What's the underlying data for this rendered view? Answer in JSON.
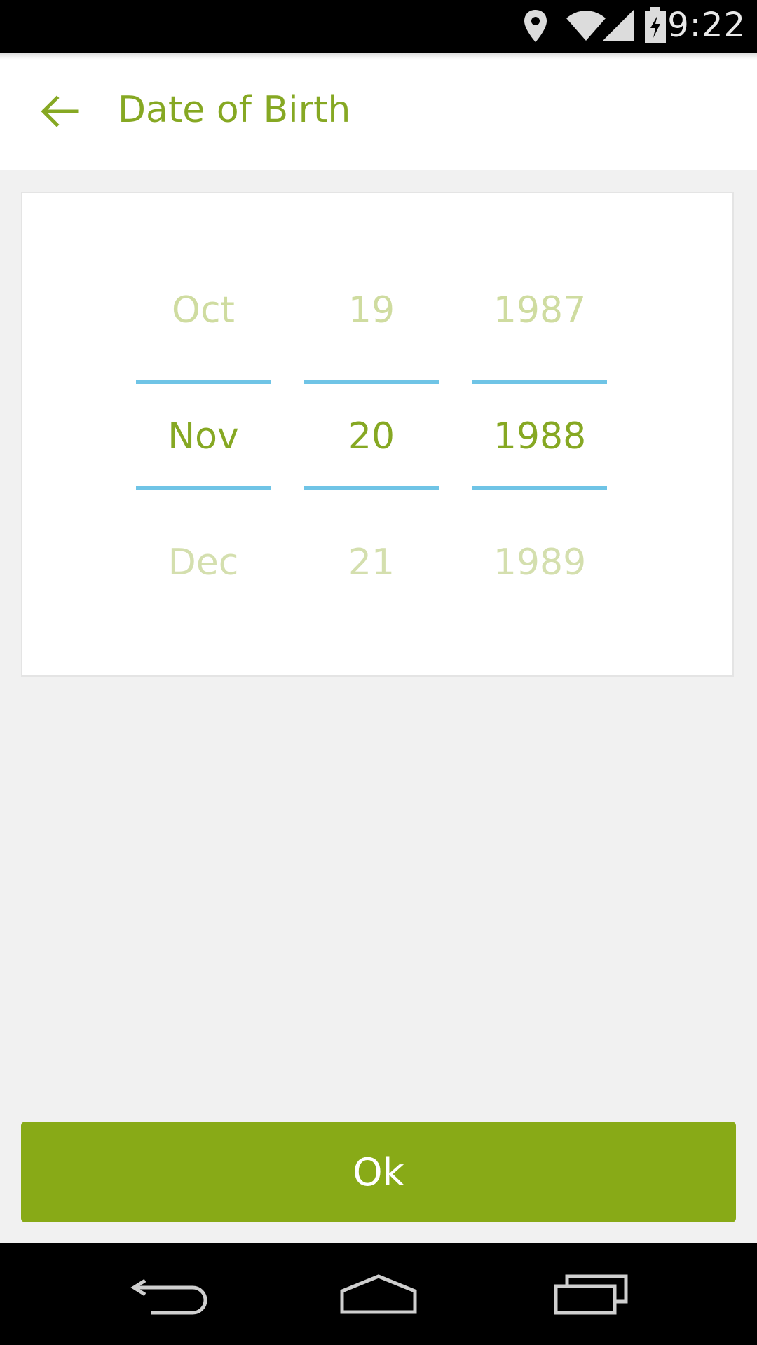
{
  "status_bar": {
    "time": "9:22",
    "icons": [
      "location-icon",
      "wifi-icon",
      "signal-icon",
      "battery-charging-icon"
    ]
  },
  "app_bar": {
    "title": "Date of Birth",
    "back_icon": "arrow-back-icon"
  },
  "date_picker": {
    "month": {
      "prev": "Oct",
      "current": "Nov",
      "next": "Dec"
    },
    "day": {
      "prev": "19",
      "current": "20",
      "next": "21"
    },
    "year": {
      "prev": "1987",
      "current": "1988",
      "next": "1989"
    }
  },
  "ok_button": {
    "label": "Ok"
  },
  "nav_bar": {
    "icons": [
      "nav-back-icon",
      "nav-home-icon",
      "nav-recents-icon"
    ]
  },
  "colors": {
    "accent": "#86a823",
    "button": "#88aa17",
    "divider": "#6fc4e6",
    "faded_text": "#cfdca0"
  }
}
